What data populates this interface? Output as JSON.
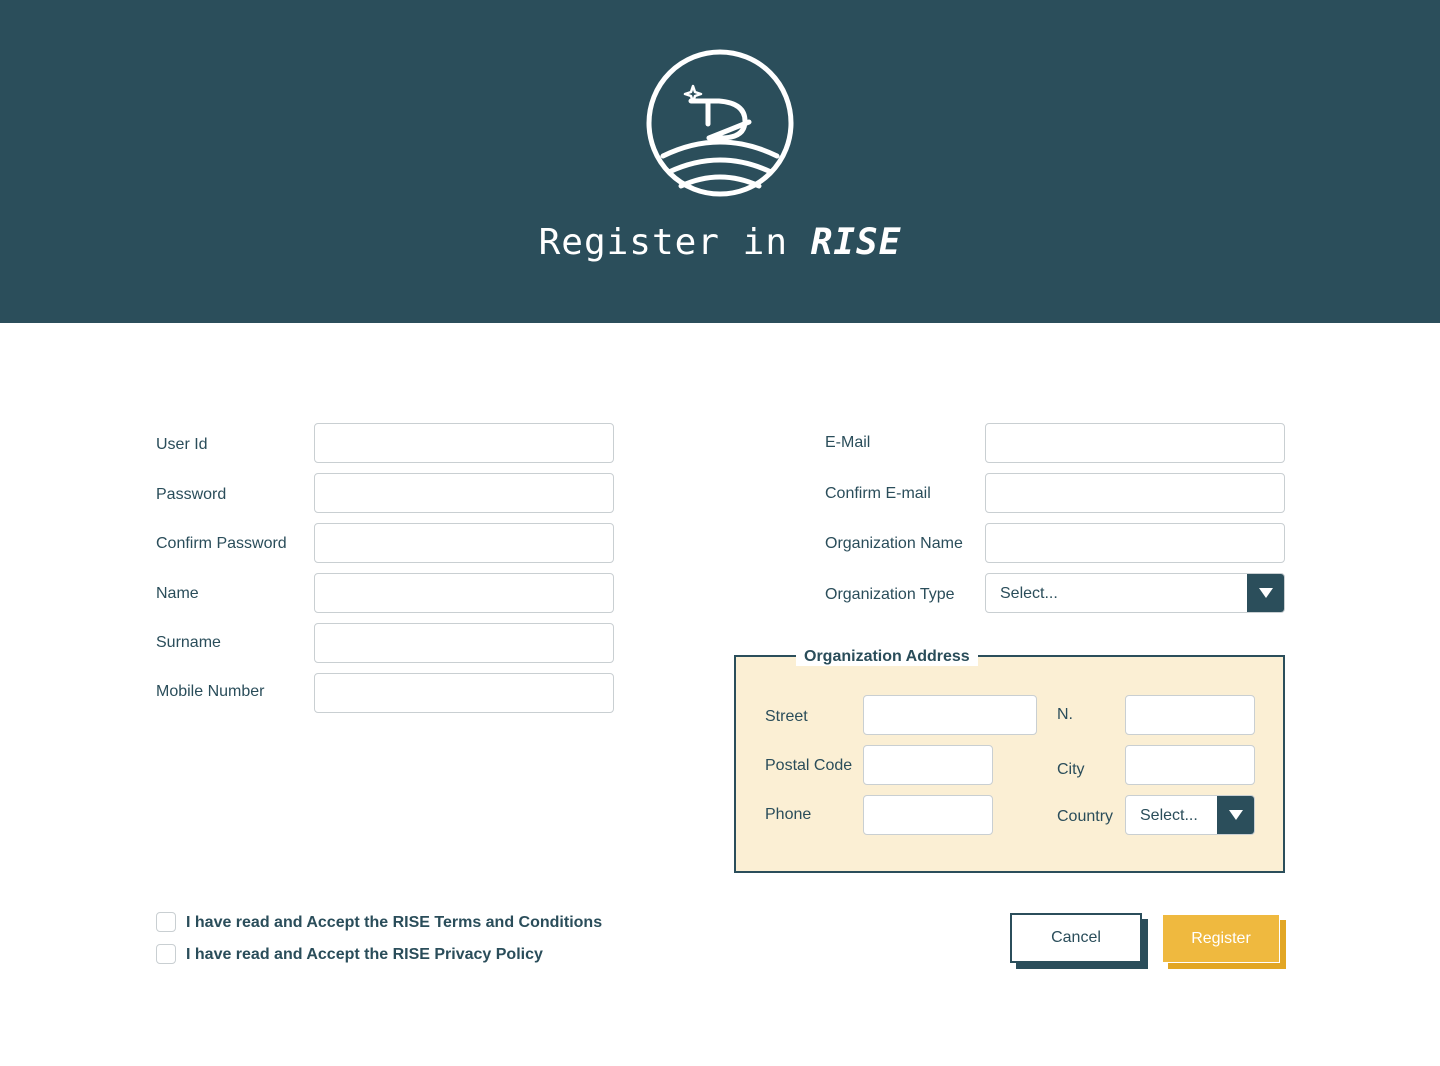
{
  "header": {
    "title_prefix": "Register in",
    "brand": "RISE",
    "logo_icon": "rise-logo-icon",
    "bg_color": "#2b4e5b"
  },
  "left_form": {
    "user_id_label": "User Id",
    "user_id_value": "",
    "password_label": "Password",
    "password_value": "",
    "confirm_password_label": "Confirm Password",
    "confirm_password_value": "",
    "name_label": "Name",
    "name_value": "",
    "surname_label": "Surname",
    "surname_value": "",
    "mobile_label": "Mobile Number",
    "mobile_value": ""
  },
  "right_form": {
    "email_label": "E-Mail",
    "email_value": "",
    "confirm_email_label": "Confirm E-mail",
    "confirm_email_value": "",
    "org_name_label": "Organization Name",
    "org_name_value": "",
    "org_type_label": "Organization Type",
    "org_type_selected": "Select..."
  },
  "address": {
    "legend": "Organization Address",
    "street_label": "Street",
    "street_value": "",
    "number_label": "N.",
    "number_value": "",
    "postal_label": "Postal Code",
    "postal_value": "",
    "city_label": "City",
    "city_value": "",
    "phone_label": "Phone",
    "phone_value": "",
    "country_label": "Country",
    "country_selected": "Select...",
    "bg_color": "#fbefd4"
  },
  "agreements": {
    "terms": "I have read and Accept the RISE Terms and Conditions",
    "privacy": "I have read and Accept the RISE Privacy Policy"
  },
  "actions": {
    "cancel": "Cancel",
    "register": "Register",
    "register_color": "#efb93f"
  }
}
